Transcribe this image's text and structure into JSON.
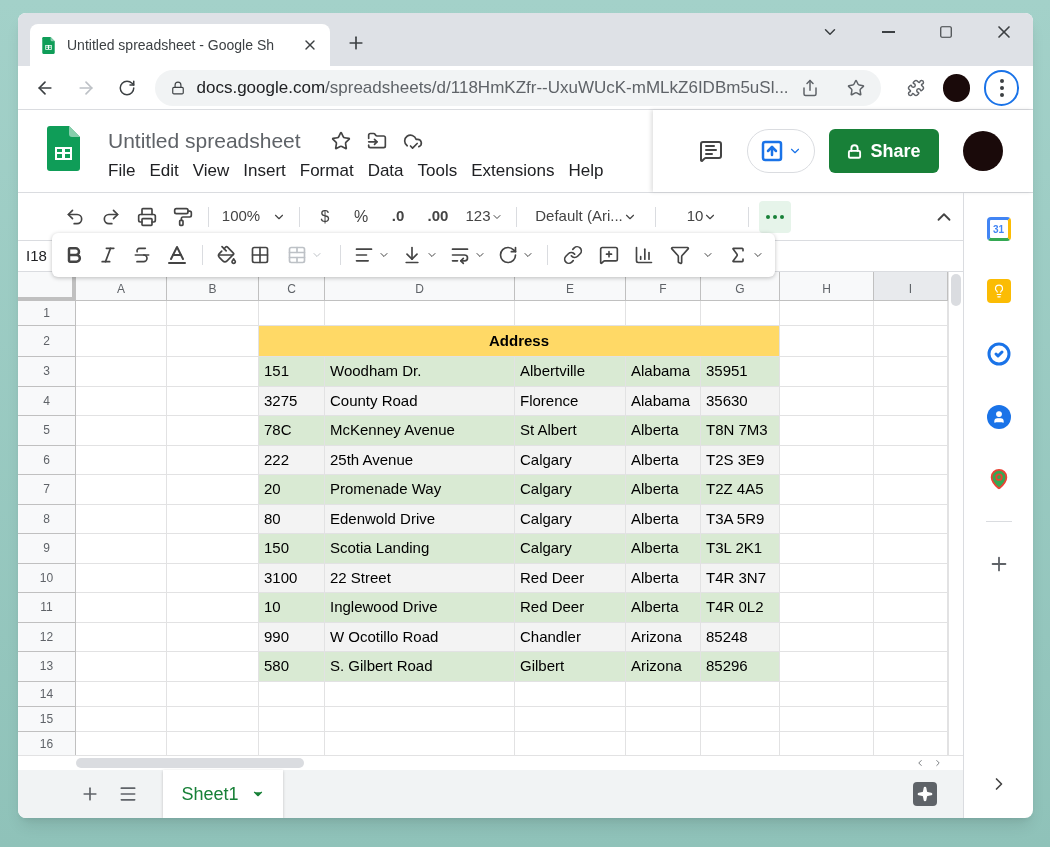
{
  "browser": {
    "tab_title": "Untitled spreadsheet - Google Sh",
    "url_host": "docs.google.com",
    "url_path": "/spreadsheets/d/118HmKZfr--UxuWUcK-mMLkZ6IDBm5uSl..."
  },
  "doc": {
    "title": "Untitled spreadsheet",
    "menu": [
      "File",
      "Edit",
      "View",
      "Insert",
      "Format",
      "Data",
      "Tools",
      "Extensions",
      "Help"
    ]
  },
  "share": {
    "label": "Share"
  },
  "toolbar": {
    "zoom": "100%",
    "currency": "$",
    "percent": "%",
    "decrease_decimals": ".0",
    "increase_decimals": ".00",
    "number_format": "123",
    "font": "Default (Ari...",
    "font_size": "10",
    "more_selected": true
  },
  "name_box": "I18",
  "columns": [
    "A",
    "B",
    "C",
    "D",
    "E",
    "F",
    "G",
    "H",
    "I"
  ],
  "rows": [
    {
      "number": "1",
      "kind": "empty"
    },
    {
      "number": "2",
      "kind": "title",
      "color": "#ffd966",
      "cells": [
        "Address"
      ]
    },
    {
      "number": "3",
      "kind": "data",
      "color": "#d9ead3",
      "cells": [
        "151",
        "Woodham Dr.",
        "Albertville",
        "Alabama",
        "35951"
      ]
    },
    {
      "number": "4",
      "kind": "data",
      "color": "#f3f3f3",
      "cells": [
        "3275",
        "County Road",
        "Florence",
        "Alabama",
        "35630"
      ]
    },
    {
      "number": "5",
      "kind": "data",
      "color": "#d9ead3",
      "cells": [
        "78C",
        "McKenney Avenue",
        "St Albert",
        "Alberta",
        "T8N 7M3"
      ]
    },
    {
      "number": "6",
      "kind": "data",
      "color": "#f3f3f3",
      "cells": [
        "222",
        "25th Avenue",
        "Calgary",
        "Alberta",
        "T2S 3E9"
      ]
    },
    {
      "number": "7",
      "kind": "data",
      "color": "#d9ead3",
      "cells": [
        "20",
        "Promenade Way",
        "Calgary",
        "Alberta",
        "T2Z 4A5"
      ]
    },
    {
      "number": "8",
      "kind": "data",
      "color": "#f3f3f3",
      "cells": [
        "80",
        "Edenwold Drive",
        "Calgary",
        "Alberta",
        "T3A 5R9"
      ]
    },
    {
      "number": "9",
      "kind": "data",
      "color": "#d9ead3",
      "cells": [
        "150",
        "Scotia Landing",
        "Calgary",
        "Alberta",
        "T3L 2K1"
      ]
    },
    {
      "number": "10",
      "kind": "data",
      "color": "#f3f3f3",
      "cells": [
        "3100",
        "22 Street",
        "Red Deer",
        "Alberta",
        "T4R 3N7"
      ]
    },
    {
      "number": "11",
      "kind": "data",
      "color": "#d9ead3",
      "cells": [
        "10",
        "Inglewood Drive",
        "Red Deer",
        "Alberta",
        "T4R 0L2"
      ]
    },
    {
      "number": "12",
      "kind": "data",
      "color": "#f3f3f3",
      "cells": [
        "990",
        "W Ocotillo Road",
        "Chandler",
        "Arizona",
        "85248"
      ]
    },
    {
      "number": "13",
      "kind": "data",
      "color": "#d9ead3",
      "cells": [
        "580",
        "S. Gilbert Road",
        "Gilbert",
        "Arizona",
        "85296"
      ]
    },
    {
      "number": "14",
      "kind": "empty"
    },
    {
      "number": "15",
      "kind": "empty"
    },
    {
      "number": "16",
      "kind": "empty"
    }
  ],
  "sheets": [
    {
      "name": "Sheet1",
      "selected": true
    }
  ],
  "side_panel": {
    "calendar_day": "31"
  }
}
